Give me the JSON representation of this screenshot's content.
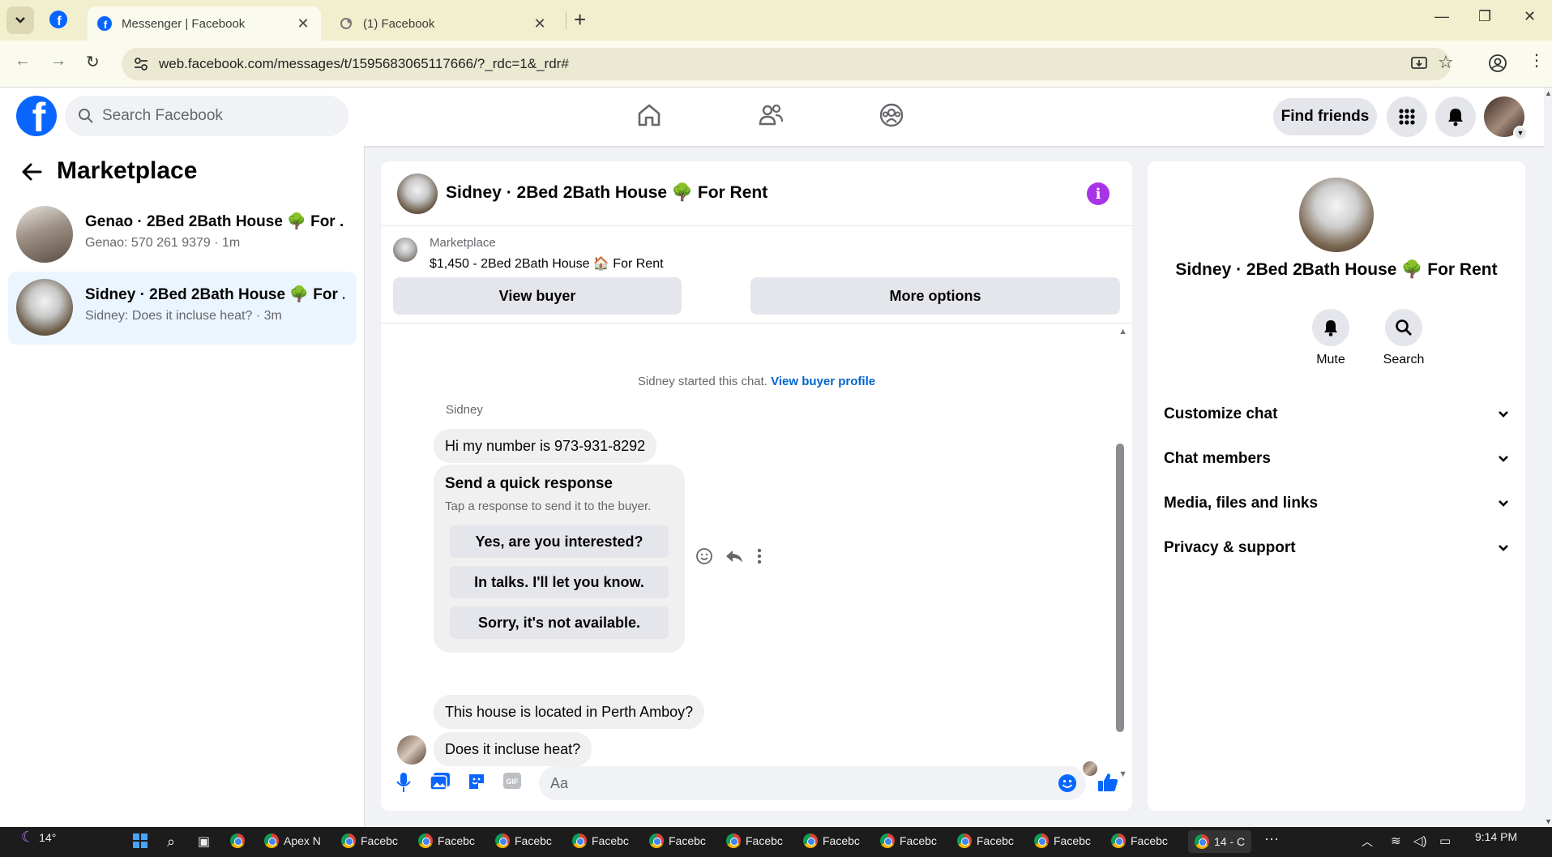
{
  "browser": {
    "tabs": [
      {
        "title": "Messenger | Facebook",
        "active": true
      },
      {
        "title": "(1) Facebook",
        "active": false
      }
    ],
    "url": "web.facebook.com/messages/t/1595683065117666/?_rdc=1&_rdr#"
  },
  "header": {
    "search_placeholder": "Search Facebook",
    "find_friends": "Find friends"
  },
  "left": {
    "title": "Marketplace",
    "conversations": [
      {
        "name": "Genao · 2Bed 2Bath House 🌳 For ...",
        "snippet": "Genao: 570 261 9379 · 1m",
        "selected": false
      },
      {
        "name": "Sidney · 2Bed 2Bath House 🌳 For ...",
        "snippet": "Sidney: Does it incluse heat? · 3m",
        "selected": true
      }
    ]
  },
  "chat": {
    "title": "Sidney · 2Bed 2Bath House 🌳 For Rent",
    "marketplace_label": "Marketplace",
    "listing": "$1,450 - 2Bed 2Bath House 🏠 For Rent",
    "view_buyer": "View buyer",
    "more_options": "More options",
    "system_text": "Sidney started this chat.",
    "system_link": "View buyer profile",
    "sender": "Sidney",
    "messages": [
      "Hi my number is 973-931-8292",
      "This house is located in Perth Amboy?",
      "Does it incluse heat?"
    ],
    "quick_response": {
      "heading": "Send a quick response",
      "subtext": "Tap a response to send it to the buyer.",
      "options": [
        "Yes, are you interested?",
        "In talks. I'll let you know.",
        "Sorry, it's not available."
      ]
    },
    "composer_placeholder": "Aa"
  },
  "right": {
    "name": "Sidney · 2Bed 2Bath House 🌳 For Rent",
    "actions": [
      "Mute",
      "Search"
    ],
    "sections": [
      "Customize chat",
      "Chat members",
      "Media, files and links",
      "Privacy & support"
    ]
  },
  "taskbar": {
    "weather": "14°",
    "items": [
      "Apex N",
      "Facebc",
      "Facebc",
      "Facebc",
      "Facebc",
      "Facebc",
      "Facebc",
      "Facebc",
      "Facebc",
      "Facebc",
      "Facebc",
      "Facebc",
      "14 - C"
    ],
    "time": "9:14 PM"
  },
  "colors": {
    "brand": "#0866ff",
    "info": "#a933e6",
    "selected_bg": "#ebf5ff"
  }
}
